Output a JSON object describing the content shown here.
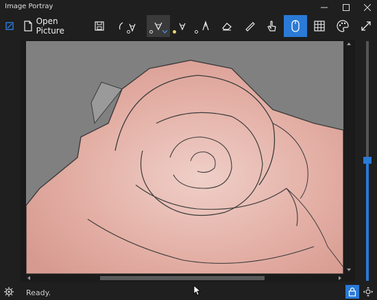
{
  "window": {
    "title": "Image Portray"
  },
  "toolbar": {
    "open_label": "Open Picture"
  },
  "status": {
    "text": "Ready."
  },
  "zoom_slider": {
    "fraction": 0.5
  },
  "colors": {
    "accent": "#2a7ad6",
    "swatch": "#e7d86a"
  }
}
